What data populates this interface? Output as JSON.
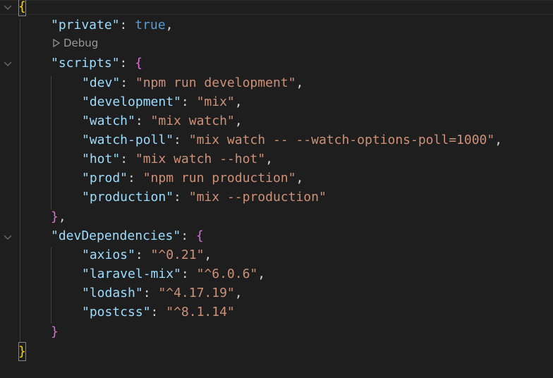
{
  "editor": {
    "codelens_label": "Debug",
    "lines": [
      {
        "open": "{"
      },
      {
        "key": "\"private\"",
        "colon": ": ",
        "value": "true",
        "tail": ","
      },
      {
        "key": "\"scripts\"",
        "colon": ": ",
        "open": "{"
      },
      {
        "key": "\"dev\"",
        "colon": ": ",
        "value": "\"npm run development\"",
        "tail": ","
      },
      {
        "key": "\"development\"",
        "colon": ": ",
        "value": "\"mix\"",
        "tail": ","
      },
      {
        "key": "\"watch\"",
        "colon": ": ",
        "value": "\"mix watch\"",
        "tail": ","
      },
      {
        "key": "\"watch-poll\"",
        "colon": ": ",
        "value": "\"mix watch -- --watch-options-poll=1000\"",
        "tail": ","
      },
      {
        "key": "\"hot\"",
        "colon": ": ",
        "value": "\"mix watch --hot\"",
        "tail": ","
      },
      {
        "key": "\"prod\"",
        "colon": ": ",
        "value": "\"npm run production\"",
        "tail": ","
      },
      {
        "key": "\"production\"",
        "colon": ": ",
        "value": "\"mix --production\""
      },
      {
        "close": "}",
        "tail": ","
      },
      {
        "key": "\"devDependencies\"",
        "colon": ": ",
        "open": "{"
      },
      {
        "key": "\"axios\"",
        "colon": ": ",
        "value": "\"^0.21\"",
        "tail": ","
      },
      {
        "key": "\"laravel-mix\"",
        "colon": ": ",
        "value": "\"^6.0.6\"",
        "tail": ","
      },
      {
        "key": "\"lodash\"",
        "colon": ": ",
        "value": "\"^4.17.19\"",
        "tail": ","
      },
      {
        "key": "\"postcss\"",
        "colon": ": ",
        "value": "\"^8.1.14\""
      },
      {
        "close": "}"
      },
      {
        "close": "}"
      }
    ]
  },
  "colors": {
    "background": "#1e1e1e",
    "key": "#9cdcfe",
    "string": "#ce9178",
    "boolean": "#569cd6",
    "bracket_level1": "#ffd700",
    "bracket_level2": "#da70d6"
  },
  "icons": {
    "fold": "chevron-down-icon",
    "codelens": "play-outline-icon"
  }
}
